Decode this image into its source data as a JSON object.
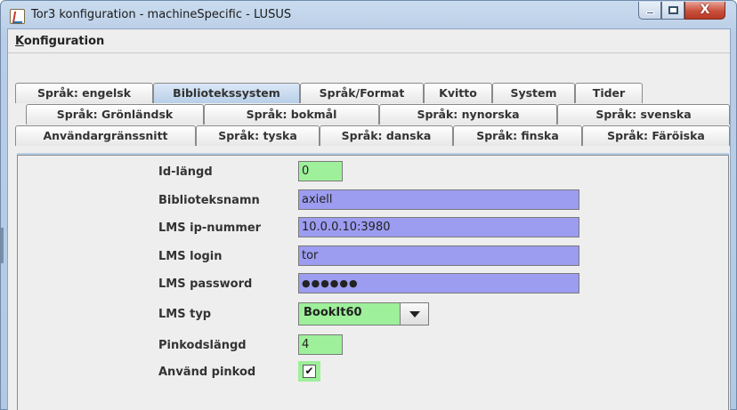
{
  "window": {
    "title": "Tor3 konfiguration - machineSpecific - LUSUS",
    "close_glyph": "X"
  },
  "menu": {
    "konfiguration_first": "K",
    "konfiguration_rest": "onfiguration"
  },
  "tabs": {
    "row1": [
      "Språk: engelsk",
      "Bibliotekssystem",
      "Språk/Format",
      "Kvitto",
      "System",
      "Tider"
    ],
    "row2": [
      "Språk: Grönländsk",
      "Språk: bokmål",
      "Språk: nynorska",
      "Språk: svenska"
    ],
    "row3": [
      "Användargränssnitt",
      "Språk: tyska",
      "Språk: danska",
      "Språk: finska",
      "Språk: Färöiska"
    ],
    "selected": "Bibliotekssystem"
  },
  "form": {
    "id_length": {
      "label": "Id-längd",
      "value": "0"
    },
    "library_name": {
      "label": "Biblioteksnamn",
      "value": "axiell"
    },
    "lms_ip": {
      "label": "LMS ip-nummer",
      "value": "10.0.0.10:3980"
    },
    "lms_login": {
      "label": "LMS login",
      "value": "tor"
    },
    "lms_password": {
      "label": "LMS password",
      "value": "●●●●●●"
    },
    "lms_type": {
      "label": "LMS typ",
      "value": "BookIt60"
    },
    "pin_length": {
      "label": "Pinkodslängd",
      "value": "4"
    },
    "use_pin": {
      "label": "Använd pinkod",
      "checked_glyph": "✔"
    }
  },
  "colors": {
    "field_green": "#9ef09a",
    "field_blue": "#9c9cf0",
    "selected_tab": "#b8cfe8"
  }
}
